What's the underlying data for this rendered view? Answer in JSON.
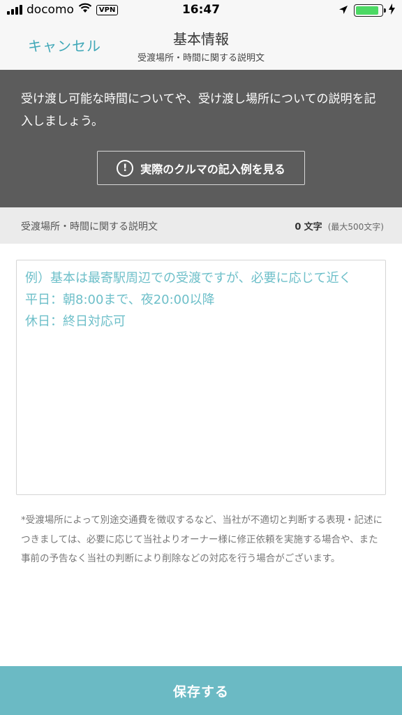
{
  "status_bar": {
    "carrier": "docomo",
    "vpn": "VPN",
    "time": "16:47",
    "battery_level": 0.9,
    "battery_color": "#4cd964"
  },
  "nav": {
    "cancel_label": "キャンセル",
    "title": "基本情報",
    "subtitle": "受渡場所・時間に関する説明文"
  },
  "banner": {
    "text": "受け渡し可能な時間についてや、受け渡し場所についての説明を記入しましょう。",
    "example_button_label": "実際のクルマの記入例を見る",
    "example_icon": "!"
  },
  "section": {
    "label": "受渡場所・時間に関する説明文",
    "count": "0",
    "count_unit": "文字",
    "max_label": "(最大500文字)"
  },
  "textarea": {
    "placeholder_lines": [
      "例）基本は最寄駅周辺での受渡ですが、必要に応じて近く",
      "平日：朝8:00まで、夜20:00以降",
      "休日：終日対応可"
    ]
  },
  "notice": {
    "text": "*受渡場所によって別途交通費を徴収するなど、当社が不適切と判断する表現・記述につきましては、必要に応じて当社よりオーナー様に修正依頼を実施する場合や、また事前の予告なく当社の判断により削除などの対応を行う場合がございます。"
  },
  "save_button": {
    "label": "保存する"
  },
  "colors": {
    "accent": "#41a8b8",
    "banner_bg": "#5c5c5c",
    "save_bg": "#6bbac4",
    "placeholder": "#6dbfc9"
  },
  "icons": [
    "signal-icon",
    "wifi-icon",
    "location-arrow-icon",
    "battery-icon",
    "charging-icon",
    "info-icon"
  ]
}
